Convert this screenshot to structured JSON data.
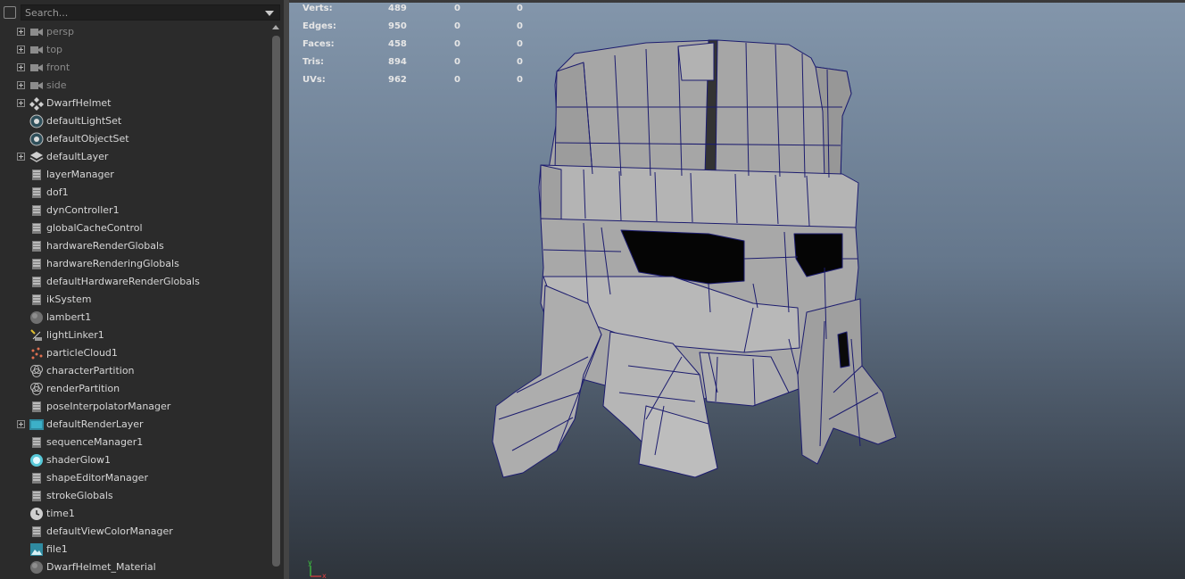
{
  "outliner": {
    "search_placeholder": "Search...",
    "items": [
      {
        "label": "persp",
        "icon": "camera-icon",
        "expandable": true,
        "dim": true
      },
      {
        "label": "top",
        "icon": "camera-icon",
        "expandable": true,
        "dim": true
      },
      {
        "label": "front",
        "icon": "camera-icon",
        "expandable": true,
        "dim": true
      },
      {
        "label": "side",
        "icon": "camera-icon",
        "expandable": true,
        "dim": true
      },
      {
        "label": "DwarfHelmet",
        "icon": "group-icon",
        "expandable": true,
        "dim": false
      },
      {
        "label": "defaultLightSet",
        "icon": "set-icon",
        "expandable": false,
        "dim": false
      },
      {
        "label": "defaultObjectSet",
        "icon": "set-icon",
        "expandable": false,
        "dim": false
      },
      {
        "label": "defaultLayer",
        "icon": "layer-icon",
        "expandable": true,
        "dim": false
      },
      {
        "label": "layerManager",
        "icon": "node-icon",
        "expandable": false,
        "dim": false
      },
      {
        "label": "dof1",
        "icon": "node-icon",
        "expandable": false,
        "dim": false
      },
      {
        "label": "dynController1",
        "icon": "node-icon",
        "expandable": false,
        "dim": false
      },
      {
        "label": "globalCacheControl",
        "icon": "node-icon",
        "expandable": false,
        "dim": false
      },
      {
        "label": "hardwareRenderGlobals",
        "icon": "node-icon",
        "expandable": false,
        "dim": false
      },
      {
        "label": "hardwareRenderingGlobals",
        "icon": "node-icon",
        "expandable": false,
        "dim": false
      },
      {
        "label": "defaultHardwareRenderGlobals",
        "icon": "node-icon",
        "expandable": false,
        "dim": false
      },
      {
        "label": "ikSystem",
        "icon": "node-icon",
        "expandable": false,
        "dim": false
      },
      {
        "label": "lambert1",
        "icon": "material-sphere-icon",
        "expandable": false,
        "dim": false
      },
      {
        "label": "lightLinker1",
        "icon": "light-linker-icon",
        "expandable": false,
        "dim": false
      },
      {
        "label": "particleCloud1",
        "icon": "particle-icon",
        "expandable": false,
        "dim": false
      },
      {
        "label": "characterPartition",
        "icon": "partition-icon",
        "expandable": false,
        "dim": false
      },
      {
        "label": "renderPartition",
        "icon": "partition-icon",
        "expandable": false,
        "dim": false
      },
      {
        "label": "poseInterpolatorManager",
        "icon": "node-icon",
        "expandable": false,
        "dim": false
      },
      {
        "label": "defaultRenderLayer",
        "icon": "render-layer-icon",
        "expandable": true,
        "dim": false
      },
      {
        "label": "sequenceManager1",
        "icon": "node-icon",
        "expandable": false,
        "dim": false
      },
      {
        "label": "shaderGlow1",
        "icon": "glow-icon",
        "expandable": false,
        "dim": false
      },
      {
        "label": "shapeEditorManager",
        "icon": "node-icon",
        "expandable": false,
        "dim": false
      },
      {
        "label": "strokeGlobals",
        "icon": "node-icon",
        "expandable": false,
        "dim": false
      },
      {
        "label": "time1",
        "icon": "clock-icon",
        "expandable": false,
        "dim": false
      },
      {
        "label": "defaultViewColorManager",
        "icon": "node-icon",
        "expandable": false,
        "dim": false
      },
      {
        "label": "file1",
        "icon": "file-texture-icon",
        "expandable": false,
        "dim": false
      },
      {
        "label": "DwarfHelmet_Material",
        "icon": "material-sphere-icon",
        "expandable": false,
        "dim": false
      }
    ]
  },
  "hud": [
    {
      "label": "Verts:",
      "values": [
        "489",
        "0",
        "0"
      ]
    },
    {
      "label": "Edges:",
      "values": [
        "950",
        "0",
        "0"
      ]
    },
    {
      "label": "Faces:",
      "values": [
        "458",
        "0",
        "0"
      ]
    },
    {
      "label": "Tris:",
      "values": [
        "894",
        "0",
        "0"
      ]
    },
    {
      "label": "UVs:",
      "values": [
        "962",
        "0",
        "0"
      ]
    }
  ],
  "axis": {
    "y": "y",
    "x": "x"
  },
  "colors": {
    "outliner_bg": "#2b2b2b",
    "viewport_top": "#8396ab",
    "viewport_bottom": "#2e343b",
    "wire": "#1c1c6e",
    "mesh": "#a9a9a9"
  }
}
